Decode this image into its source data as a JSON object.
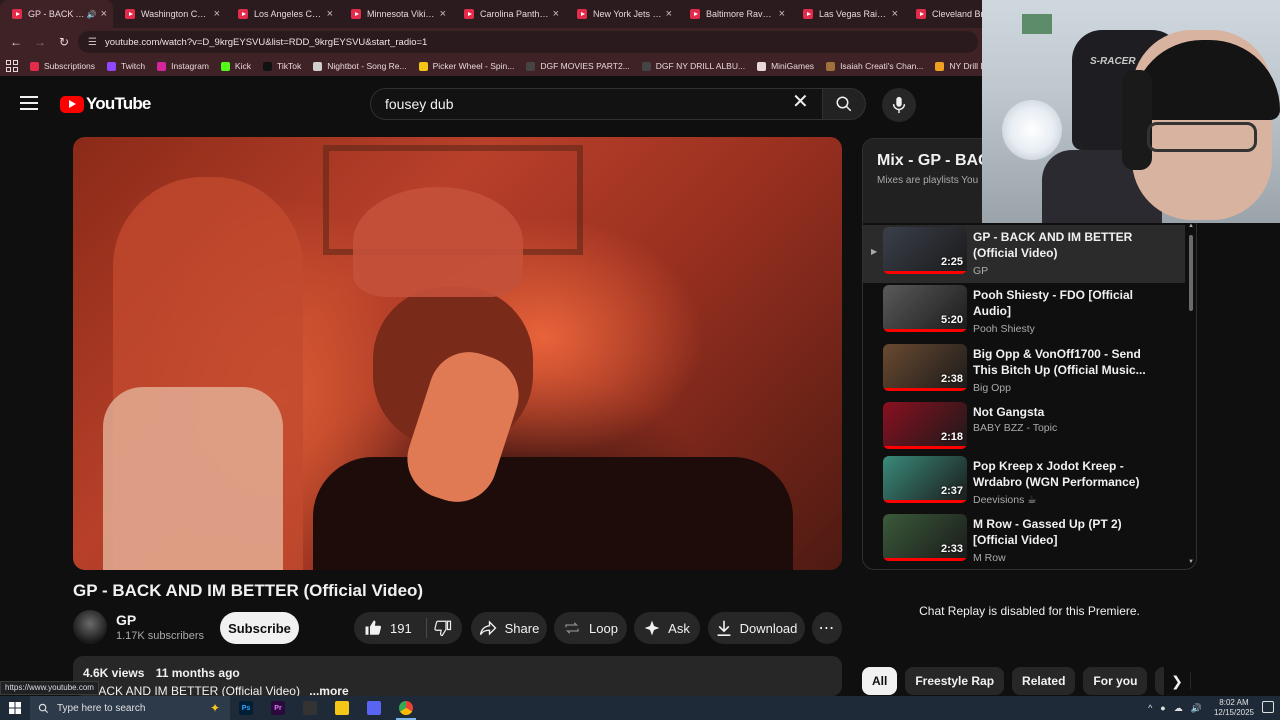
{
  "browser": {
    "tabs": [
      {
        "title": "GP - BACK AND IM BETTER",
        "active": true,
        "audio": true
      },
      {
        "title": "Washington Commanders",
        "active": false
      },
      {
        "title": "Los Angeles Chargers",
        "active": false
      },
      {
        "title": "Minnesota Vikings",
        "active": false
      },
      {
        "title": "Carolina Panthers",
        "active": false
      },
      {
        "title": "New York Jets vs.",
        "active": false
      },
      {
        "title": "Baltimore Ravens",
        "active": false
      },
      {
        "title": "Las Vegas Raiders",
        "active": false
      },
      {
        "title": "Cleveland Browns",
        "active": false
      }
    ],
    "url": "youtube.com/watch?v=D_9krgEYSVU&list=RDD_9krgEYSVU&start_radio=1",
    "bookmarks": [
      {
        "label": "Subscriptions",
        "color": "#e32b4b"
      },
      {
        "label": "Twitch",
        "color": "#9146ff"
      },
      {
        "label": "Instagram",
        "color": "#d6249f"
      },
      {
        "label": "Kick",
        "color": "#53fc18"
      },
      {
        "label": "TikTok",
        "color": "#111111"
      },
      {
        "label": "Nightbot - Song Re...",
        "color": "#cfcfcf"
      },
      {
        "label": "Picker Wheel - Spin...",
        "color": "#f5c518"
      },
      {
        "label": "DGF MOVIES PART2...",
        "color": "#444444"
      },
      {
        "label": "DGF NY DRILL ALBU...",
        "color": "#444444"
      },
      {
        "label": "MiniGames",
        "color": "#e8d8da"
      },
      {
        "label": "Isaiah Creati's Chan...",
        "color": "#a0703a"
      },
      {
        "label": "NY Drill Deads Quiz...",
        "color": "#f0a020"
      }
    ],
    "status_url": "https://www.youtube.com"
  },
  "youtube": {
    "logo_text": "YouTube",
    "search_query": "fousey dub",
    "video": {
      "title": "GP - BACK AND IM BETTER (Official Video)",
      "channel": "GP",
      "subscribers": "1.17K subscribers",
      "subscribe_label": "Subscribe",
      "likes": "191",
      "share_label": "Share",
      "loop_label": "Loop",
      "ask_label": "Ask",
      "download_label": "Download",
      "views": "4.6K views",
      "age": "11 months ago",
      "desc_line": "- BACK AND IM BETTER (Official Video)",
      "more_label": "...more"
    },
    "playlist": {
      "title": "Mix - GP - BAC",
      "subtitle": "Mixes are playlists You",
      "items": [
        {
          "title": "GP - BACK AND IM BETTER (Official Video)",
          "channel": "GP",
          "duration": "2:25",
          "current": true,
          "thumb_color": "#3a3f4a"
        },
        {
          "title": "Pooh Shiesty - FDO [Official Audio]",
          "channel": "Pooh Shiesty",
          "duration": "5:20",
          "current": false,
          "thumb_color": "#5a5a5a"
        },
        {
          "title": "Big Opp & VonOff1700 - Send This Bitch Up (Official Music...",
          "channel": "Big Opp",
          "duration": "2:38",
          "current": false,
          "thumb_color": "#6a4a30"
        },
        {
          "title": "Not Gangsta",
          "channel": "BABY BZZ - Topic",
          "duration": "2:18",
          "current": false,
          "thumb_color": "#8a1020"
        },
        {
          "title": "Pop Kreep x Jodot Kreep - Wrdabro (WGN Performance)",
          "channel": "Deevisions ☕",
          "duration": "2:37",
          "current": false,
          "thumb_color": "#3a8a7a"
        },
        {
          "title": "M Row - Gassed Up (PT 2) [Official Video]",
          "channel": "M Row",
          "duration": "2:33",
          "current": false,
          "thumb_color": "#3a5a3a"
        }
      ]
    },
    "chat_replay": "Chat Replay is disabled for this Premiere.",
    "chips": [
      "All",
      "Freestyle Rap",
      "Related",
      "For you",
      "Re"
    ]
  },
  "webcam": {
    "chair_text": "S-RACER"
  },
  "taskbar": {
    "search_placeholder": "Type here to search",
    "time": "8:02 AM",
    "date": "12/15/2025",
    "apps": [
      {
        "name": "Ps",
        "color": "#001e36",
        "fg": "#31a8ff"
      },
      {
        "name": "Pr",
        "color": "#2a0a3a",
        "fg": "#ea77ff"
      },
      {
        "name": "",
        "color": "#333"
      },
      {
        "name": "",
        "color": "#f5c518"
      },
      {
        "name": "",
        "color": "#5865f2"
      },
      {
        "name": "",
        "color": "#ffffff"
      }
    ]
  }
}
